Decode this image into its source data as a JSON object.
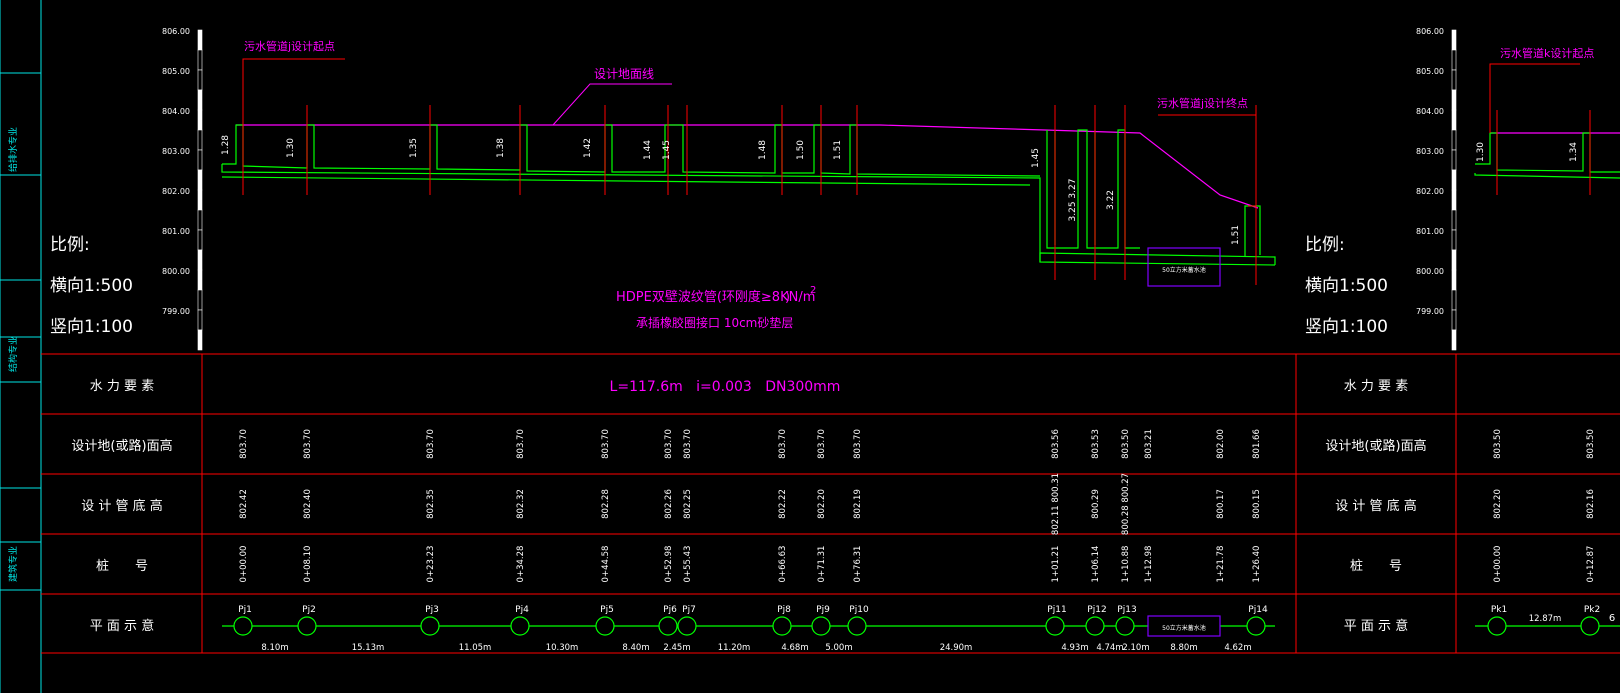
{
  "colors": {
    "background": "#000000",
    "grid": "#ff0000",
    "pipe": "#00ff00",
    "ground": "#ff00ff",
    "label": "#ff00ff",
    "white": "#ffffff",
    "frame": "#00e5e5",
    "tank": "#7f00ff"
  },
  "left_frame_labels": [
    "给排水专业",
    "结构专业",
    "建筑专业"
  ],
  "elevation_ticks": [
    "806.00",
    "805.00",
    "804.00",
    "803.00",
    "802.00",
    "801.00",
    "800.00",
    "799.00"
  ],
  "scale": {
    "title": "比例:",
    "horizontal": "横向1:500",
    "vertical": "竖向1:100"
  },
  "annotations": {
    "start_point": "污水管道j设计起点",
    "ground_line": "设计地面线",
    "end_point": "污水管道j设计终点",
    "start_point_k": "污水管道k设计起点",
    "pipe_spec": "HDPE双壁波纹管(环刚度≥8KN/m",
    "pipe_spec_close": ")",
    "pipe_spec_sup": "2",
    "bedding": "承插橡胶圈接口 10cm砂垫层",
    "tank": "50立方米蓄水池"
  },
  "row_headers": [
    "水 力 要 素",
    "设计地(或路)面高",
    "设 计 管 底 高",
    "桩　　号",
    "平 面 示 意"
  ],
  "row_headers_right": [
    "水 力 要 素",
    "设计地(或路)面高",
    "设 计 管 底 高",
    "桩　　号",
    "平 面 示 意"
  ],
  "hydraulic": "L=117.6m   i=0.003   DN300mm",
  "depth_labels": [
    "1.28",
    "1.30",
    "1.35",
    "1.38",
    "1.42",
    "1.44",
    "1.45",
    "1.48",
    "1.50",
    "1.51",
    "1.45",
    "3.25 3.27",
    "3.22",
    "1.51"
  ],
  "depth_labels_right": [
    "1.30",
    "1.34"
  ],
  "ground_elev": [
    "803.70",
    "803.70",
    "803.70",
    "803.70",
    "803.70",
    "803.70",
    "803.70",
    "803.70",
    "803.70",
    "803.70",
    "803.56",
    "803.53",
    "803.50",
    "803.21",
    "802.00",
    "801.66"
  ],
  "invert_elev": [
    "802.42",
    "802.40",
    "802.35",
    "802.32",
    "802.28",
    "802.26",
    "802.25",
    "802.22",
    "802.20",
    "802.19",
    "802.11 800.31",
    "800.29",
    "800.28 800.27",
    "800.17",
    "800.15"
  ],
  "stations": [
    "0+00.00",
    "0+08.10",
    "0+23.23",
    "0+34.28",
    "0+44.58",
    "0+52.98",
    "0+55.43",
    "0+66.63",
    "0+71.31",
    "0+76.31",
    "1+01.21",
    "1+06.14",
    "1+10.88",
    "1+12.98",
    "1+21.78",
    "1+26.40"
  ],
  "manholes": [
    "Pj1",
    "Pj2",
    "Pj3",
    "Pj4",
    "Pj5",
    "Pj6",
    "Pj7",
    "Pj8",
    "Pj9",
    "Pj10",
    "Pj11",
    "Pj12",
    "Pj13",
    "Pj14"
  ],
  "segments": [
    "8.10m",
    "15.13m",
    "11.05m",
    "10.30m",
    "8.40m",
    "2.45m",
    "11.20m",
    "4.68m",
    "5.00m",
    "24.90m",
    "4.93m",
    "4.74m",
    "2.10m",
    "8.80m",
    "4.62m"
  ],
  "right_panel": {
    "ground_elev": [
      "803.50",
      "803.50"
    ],
    "invert_elev": [
      "802.20",
      "802.16"
    ],
    "stations": [
      "0+00.00",
      "0+12.87"
    ],
    "manholes": [
      "Pk1",
      "Pk2"
    ],
    "segment": "12.87m",
    "cut_text": "6"
  }
}
